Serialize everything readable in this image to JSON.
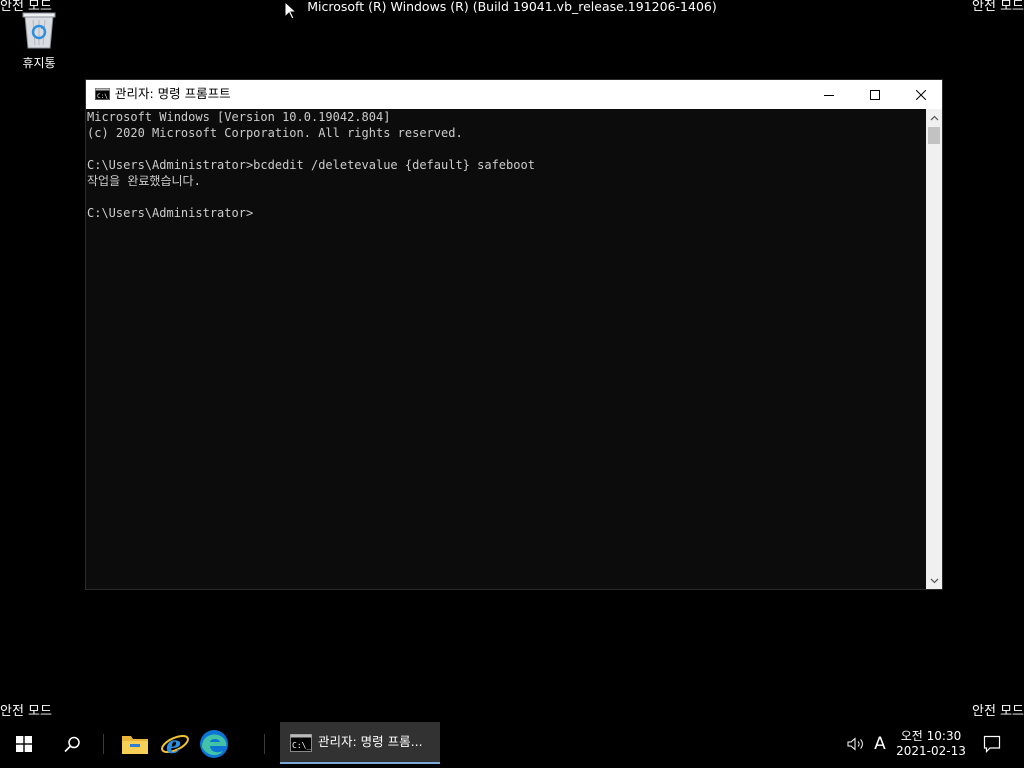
{
  "desktop": {
    "corner_watermark": "안전 모드",
    "build_text": "Microsoft (R) Windows (R) (Build 19041.vb_release.191206-1406)",
    "icons": [
      {
        "name": "recycle-bin",
        "label": "휴지통"
      }
    ]
  },
  "window": {
    "title": "관리자: 명령 프롬프트",
    "controls": {
      "minimize": "minimize-icon",
      "maximize": "maximize-icon",
      "close": "close-icon"
    },
    "console_lines": [
      "Microsoft Windows [Version 10.0.19042.804]",
      "(c) 2020 Microsoft Corporation. All rights reserved.",
      "",
      "C:\\Users\\Administrator>bcdedit /deletevalue {default} safeboot",
      "작업을 완료했습니다.",
      "",
      "C:\\Users\\Administrator>"
    ],
    "colors": {
      "console_bg": "#0c0c0c",
      "console_text": "#cccccc",
      "titlebar_bg": "#ffffff"
    }
  },
  "taskbar": {
    "start": "windows-logo-icon",
    "search": "search-icon",
    "pinned": [
      {
        "name": "file-explorer-icon"
      },
      {
        "name": "internet-explorer-icon"
      },
      {
        "name": "edge-icon"
      }
    ],
    "task_label": "관리자: 명령 프롬...",
    "tray": {
      "volume": "volume-icon",
      "ime_label": "A",
      "time": "오전 10:30",
      "date": "2021-02-13",
      "notifications": "notification-icon"
    },
    "accent": "#78a9d6"
  }
}
